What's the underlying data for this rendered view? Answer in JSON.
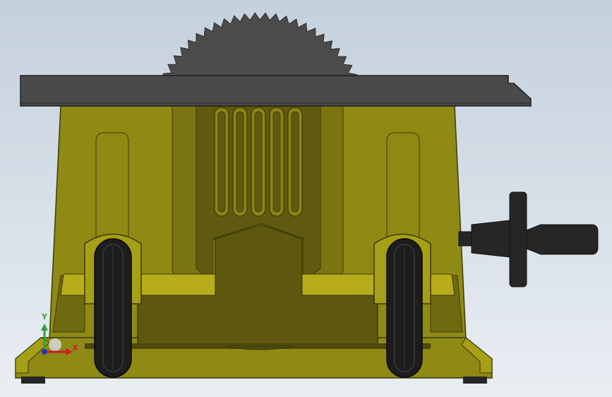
{
  "viewport": {
    "background_top": "#c4d0dc",
    "background_bottom": "#e9eef3"
  },
  "model": {
    "parts": [
      "saw-blade",
      "table-top",
      "housing",
      "vent-slots",
      "left-wheel",
      "right-wheel",
      "crank-handle",
      "feet"
    ],
    "colors": {
      "housing": "#8f8a14",
      "housing_dark": "#5d5710",
      "housing_light": "#b7ac1b",
      "blade": "#4b4b4b",
      "table_top": "#4a4a4a",
      "tire": "#1d1d1d",
      "handle": "#262626"
    }
  },
  "triad": {
    "y_label": "Y",
    "x_label": "X",
    "y_color": "#2fa23a",
    "x_color": "#c8202a",
    "z_color": "#2436b8"
  }
}
